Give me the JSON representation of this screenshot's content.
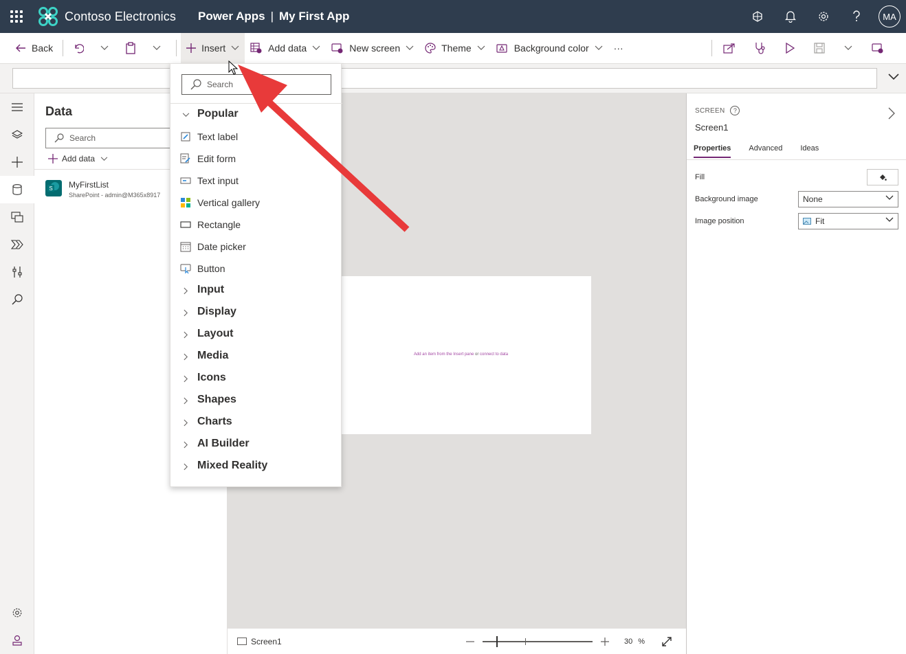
{
  "header": {
    "brand_name": "Contoso Electronics",
    "product": "Power Apps",
    "separator": "|",
    "app_name": "My First App",
    "avatar_initials": "MA"
  },
  "commandbar": {
    "back": "Back",
    "insert": "Insert",
    "add_data": "Add data",
    "new_screen": "New screen",
    "theme": "Theme",
    "background_color": "Background color",
    "more": "···"
  },
  "datapane": {
    "title": "Data",
    "search_placeholder": "Search",
    "add_data": "Add data",
    "sources": [
      {
        "name": "MyFirstList",
        "subtitle": "SharePoint - admin@M365x8917"
      }
    ]
  },
  "canvas": {
    "hint_part1": "Add an item from the Insert pane",
    "hint_or": "or",
    "hint_part2": "connect to data"
  },
  "statusbar": {
    "screen_name": "Screen1",
    "zoom_value": "30",
    "zoom_unit": "%"
  },
  "properties": {
    "kind": "SCREEN",
    "help": "?",
    "name": "Screen1",
    "tabs": [
      "Properties",
      "Advanced",
      "Ideas"
    ],
    "fill_label": "Fill",
    "background_image_label": "Background image",
    "background_image_value": "None",
    "image_position_label": "Image position",
    "image_position_value": "Fit"
  },
  "insert_menu": {
    "search_placeholder": "Search",
    "popular_group": "Popular",
    "items": [
      "Text label",
      "Edit form",
      "Text input",
      "Vertical gallery",
      "Rectangle",
      "Date picker",
      "Button"
    ],
    "groups": [
      "Input",
      "Display",
      "Layout",
      "Media",
      "Icons",
      "Shapes",
      "Charts",
      "AI Builder",
      "Mixed Reality"
    ]
  },
  "colors": {
    "header_bg": "#2f3d4e",
    "accent": "#742774",
    "annotation_arrow": "#e83a3a"
  }
}
